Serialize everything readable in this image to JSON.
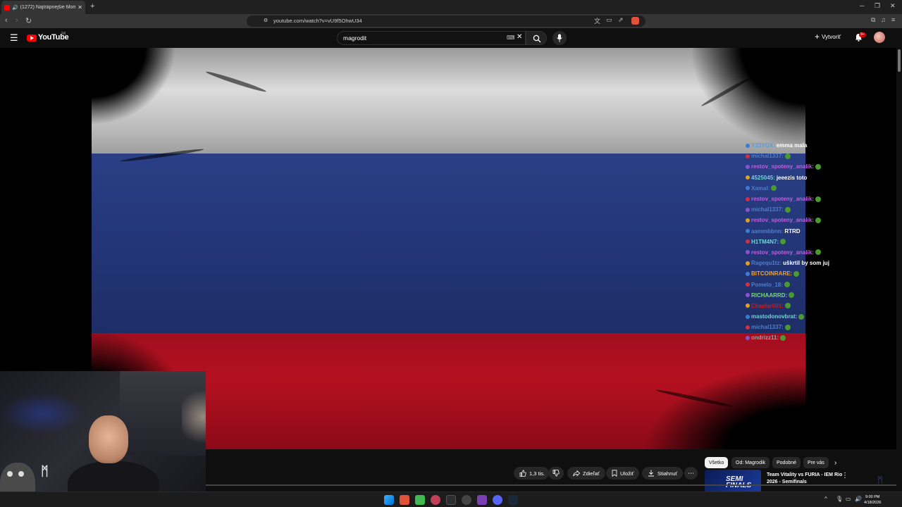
{
  "browser": {
    "tab_title": "(1272) Najtrápnejšie Momen",
    "url": "youtube.com/watch?v=vU9f5OhwU34"
  },
  "youtube": {
    "brand": "YouTube",
    "country_code": "SK",
    "search_value": "magrodit",
    "create_label": "Vytvoriť",
    "notification_count": "9+",
    "actions": {
      "like_count": "1,3 tis.",
      "share_label": "Zdieľať",
      "save_label": "Uložiť",
      "download_label": "Stiahnuť"
    },
    "chips": [
      "Všetko",
      "Od: Magrodik",
      "Podobné",
      "Pre vás"
    ],
    "recommendation": {
      "title": "Team Vitality vs FURIA - IEM Rio 2026 - Semifinals",
      "thumb_text": "SEMI FINALS"
    }
  },
  "stream_chat": [
    {
      "user": "Y33YOX:",
      "text": "emma mala",
      "color": "#5b9ad6"
    },
    {
      "user": "michal1337:",
      "text": "",
      "color": "#4f7ec9"
    },
    {
      "user": "restov_spoteny_analik:",
      "text": "",
      "color": "#c05fe0"
    },
    {
      "user": "4525045:",
      "text": "jeeezis toto",
      "color": "#6fd3d3"
    },
    {
      "user": "Xamal:",
      "text": "",
      "color": "#4f7ec9"
    },
    {
      "user": "restov_spoteny_analik:",
      "text": "",
      "color": "#c05fe0"
    },
    {
      "user": "michal1337:",
      "text": "",
      "color": "#4f7ec9"
    },
    {
      "user": "restov_spoteny_analik:",
      "text": "",
      "color": "#c05fe0"
    },
    {
      "user": "aammbbnn:",
      "text": "RTRD",
      "color": "#4f7ec9"
    },
    {
      "user": "H1TM4N7:",
      "text": "",
      "color": "#6fd3d3"
    },
    {
      "user": "restov_spoteny_analik:",
      "text": "",
      "color": "#c05fe0"
    },
    {
      "user": "Ragequ1tz:",
      "text": "uškrtil by som juj",
      "color": "#4f7ec9"
    },
    {
      "user": "BITCOINRARE:",
      "text": "",
      "color": "#f0a030"
    },
    {
      "user": "Pomelo_18:",
      "text": "",
      "color": "#4f7ec9"
    },
    {
      "user": "RICHAARRD:",
      "text": "",
      "color": "#7ad67a"
    },
    {
      "user": "Chaplar001:",
      "text": "",
      "color": "#d01818"
    },
    {
      "user": "mastodonovbrat:",
      "text": "",
      "color": "#6fd3d3"
    },
    {
      "user": "michal1337:",
      "text": "",
      "color": "#4f7ec9"
    },
    {
      "user": "ondrizz11:",
      "text": "",
      "color": "#9aa0a0"
    }
  ],
  "taskbar": {
    "time": "9:00 PM",
    "date": "4/18/2026"
  }
}
